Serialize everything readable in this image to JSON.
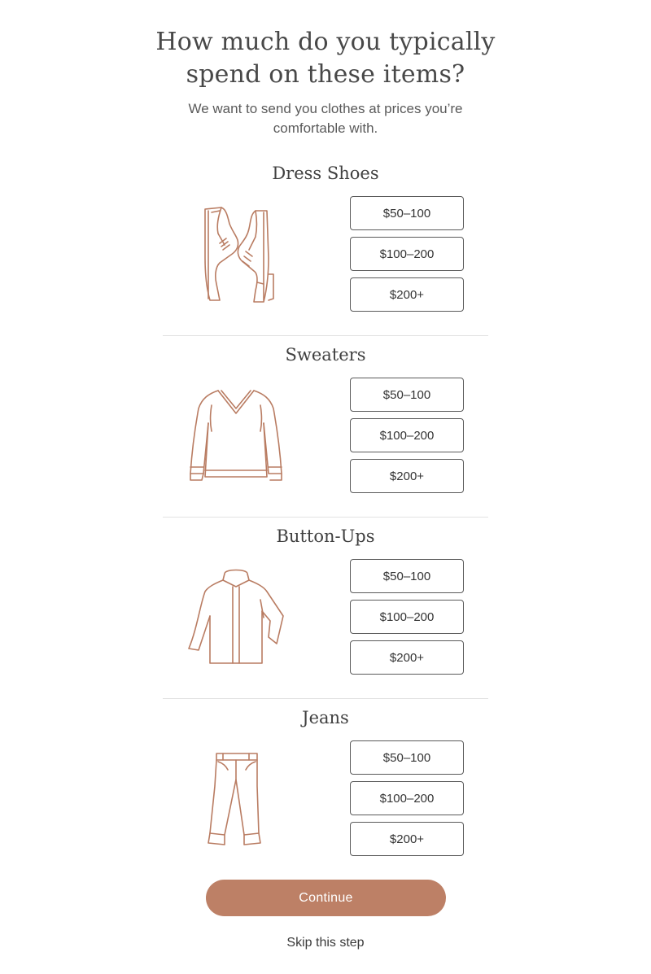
{
  "header": {
    "title_line1": "How much do you typically",
    "title_line2": "spend on these items?",
    "subtitle_line1": "We want to send you clothes at prices you’re",
    "subtitle_line2": "comfortable with."
  },
  "categories": [
    {
      "name": "Dress Shoes",
      "icon": "dress-shoes-icon",
      "options": [
        "$50–100",
        "$100–200",
        "$200+"
      ]
    },
    {
      "name": "Sweaters",
      "icon": "sweater-icon",
      "options": [
        "$50–100",
        "$100–200",
        "$200+"
      ]
    },
    {
      "name": "Button-Ups",
      "icon": "button-up-shirt-icon",
      "options": [
        "$50–100",
        "$100–200",
        "$200+"
      ]
    },
    {
      "name": "Jeans",
      "icon": "jeans-icon",
      "options": [
        "$50–100",
        "$100–200",
        "$200+"
      ]
    }
  ],
  "actions": {
    "continue_label": "Continue",
    "skip_label": "Skip this step"
  },
  "colors": {
    "accent": "#bd8066",
    "illustration_stroke": "#b97c62",
    "button_border": "#5a5a5a",
    "divider": "#e2e2e2"
  }
}
